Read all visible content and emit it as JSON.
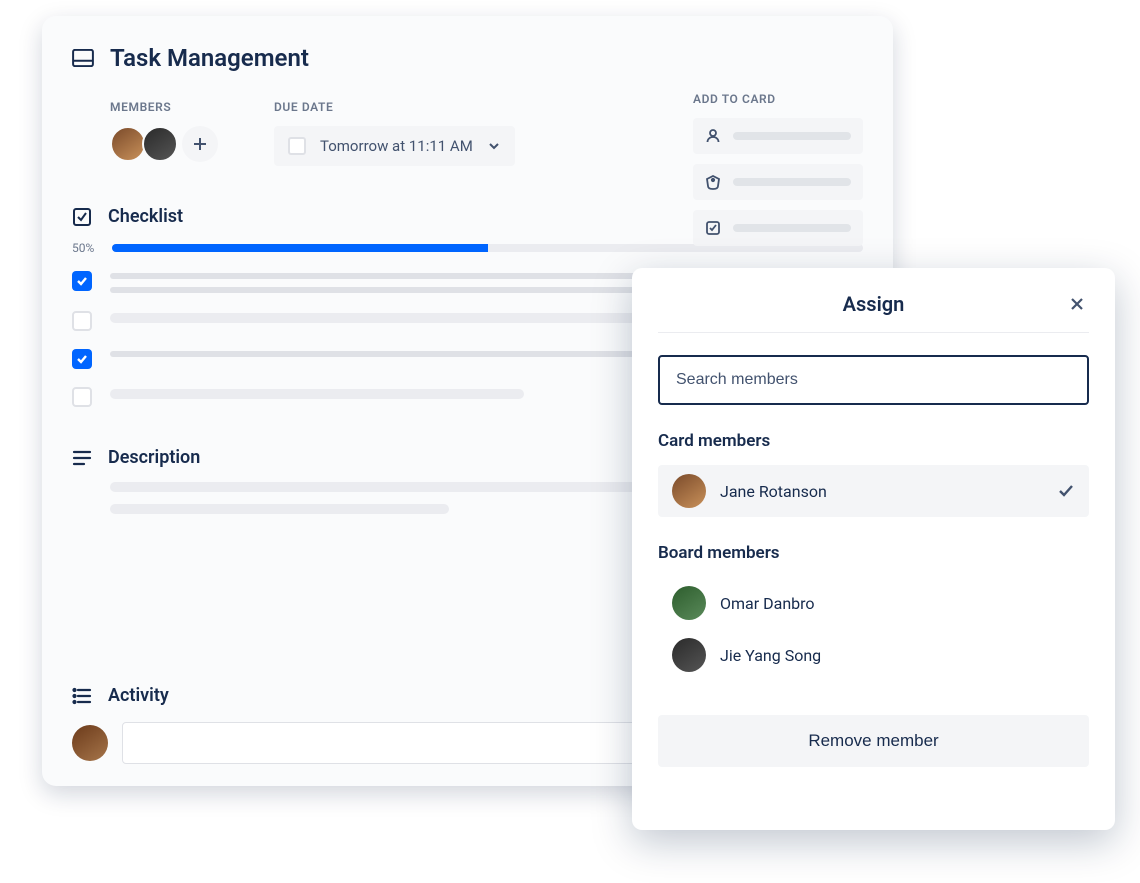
{
  "card": {
    "title": "Task Management",
    "members_label": "MEMBERS",
    "due_label": "DUE DATE",
    "due_text": "Tomorrow at 11:11 AM",
    "add_to_card_label": "ADD TO CARD"
  },
  "checklist": {
    "title": "Checklist",
    "progress_pct": "50%",
    "progress_value": 50,
    "items": [
      {
        "checked": true
      },
      {
        "checked": false
      },
      {
        "checked": true
      },
      {
        "checked": false
      }
    ]
  },
  "description": {
    "title": "Description"
  },
  "activity": {
    "title": "Activity"
  },
  "assign": {
    "title": "Assign",
    "search_placeholder": "Search members",
    "card_members_label": "Card members",
    "board_members_label": "Board members",
    "card_members": [
      {
        "name": "Jane Rotanson",
        "selected": true
      }
    ],
    "board_members": [
      {
        "name": "Omar Danbro"
      },
      {
        "name": "Jie Yang Song"
      }
    ],
    "remove_label": "Remove member"
  },
  "colors": {
    "primary": "#0065FF",
    "text": "#172B4D",
    "muted": "#6B778C"
  }
}
